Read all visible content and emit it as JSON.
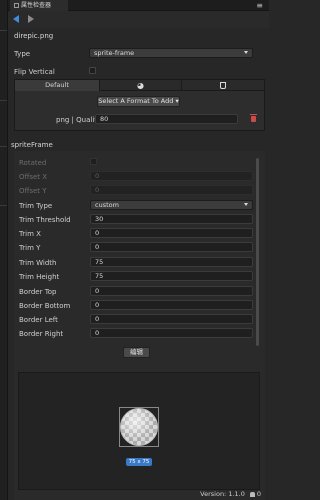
{
  "tab": {
    "title": "属性检查器",
    "menu_icon": "hamburger-menu-icon"
  },
  "nav": {
    "back_icon": "arrow-left-icon",
    "forward_icon": "arrow-right-icon"
  },
  "asset": {
    "filename": "direpic.png"
  },
  "type_row": {
    "label": "Type",
    "value": "sprite-frame"
  },
  "flip_row": {
    "label": "Flip Vertical",
    "checked": false
  },
  "format_panel": {
    "tabs": [
      {
        "label": "Default"
      },
      {
        "icon": "wechat-icon"
      },
      {
        "icon": "html5-icon"
      }
    ],
    "add_button": "Select A Format To Add",
    "quality_label": "png | Quality",
    "quality_value": "80",
    "delete_icon": "trash-icon"
  },
  "sprite_frame": {
    "title": "spriteFrame",
    "fields": [
      {
        "label": "Rotated",
        "kind": "checkbox",
        "disabled": true
      },
      {
        "label": "Offset X",
        "kind": "number",
        "value": "0",
        "disabled": true
      },
      {
        "label": "Offset Y",
        "kind": "number",
        "value": "0",
        "disabled": true
      },
      {
        "label": "Trim Type",
        "kind": "select",
        "value": "custom"
      },
      {
        "label": "Trim Threshold",
        "kind": "number",
        "value": "30"
      },
      {
        "label": "Trim X",
        "kind": "number",
        "value": "0"
      },
      {
        "label": "Trim Y",
        "kind": "number",
        "value": "0"
      },
      {
        "label": "Trim Width",
        "kind": "number",
        "value": "75"
      },
      {
        "label": "Trim Height",
        "kind": "number",
        "value": "75"
      },
      {
        "label": "Border Top",
        "kind": "number",
        "value": "0"
      },
      {
        "label": "Border Bottom",
        "kind": "number",
        "value": "0"
      },
      {
        "label": "Border Left",
        "kind": "number",
        "value": "0"
      },
      {
        "label": "Border Right",
        "kind": "number",
        "value": "0"
      }
    ],
    "edit_button": "编辑"
  },
  "preview": {
    "size_badge": "75 x 75"
  },
  "footer": {
    "version": "Version: 1.1.0",
    "notifications": "0"
  },
  "colors": {
    "accent": "#3e8edb",
    "danger": "#c94b4b",
    "badge": "#3a78c8"
  }
}
